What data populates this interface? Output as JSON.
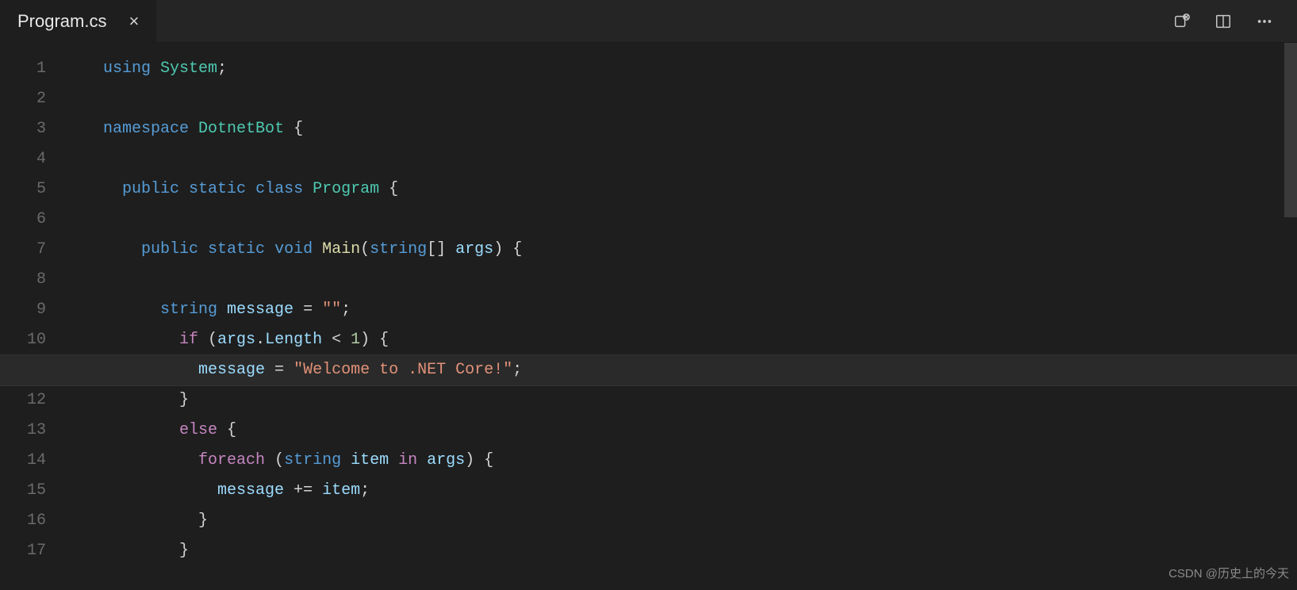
{
  "tab": {
    "title": "Program.cs"
  },
  "icons": {
    "openChanges": "open-changes-icon",
    "splitEditor": "split-editor-icon",
    "more": "more-icon"
  },
  "editor": {
    "lineStart": 1,
    "lineCount": 17,
    "highlightLine": 11,
    "code": {
      "l1": [
        [
          "kw",
          "using"
        ],
        [
          "pn",
          " "
        ],
        [
          "type",
          "System"
        ],
        [
          "pn",
          ";"
        ]
      ],
      "l2": [],
      "l3": [
        [
          "kw",
          "namespace"
        ],
        [
          "pn",
          " "
        ],
        [
          "type",
          "DotnetBot"
        ],
        [
          "pn",
          " {"
        ]
      ],
      "l4": [],
      "l5": [
        [
          "pn",
          "  "
        ],
        [
          "kw",
          "public"
        ],
        [
          "pn",
          " "
        ],
        [
          "kw",
          "static"
        ],
        [
          "pn",
          " "
        ],
        [
          "kw",
          "class"
        ],
        [
          "pn",
          " "
        ],
        [
          "type",
          "Program"
        ],
        [
          "pn",
          " {"
        ]
      ],
      "l6": [],
      "l7": [
        [
          "pn",
          "    "
        ],
        [
          "kw",
          "public"
        ],
        [
          "pn",
          " "
        ],
        [
          "kw",
          "static"
        ],
        [
          "pn",
          " "
        ],
        [
          "kw",
          "void"
        ],
        [
          "pn",
          " "
        ],
        [
          "fn",
          "Main"
        ],
        [
          "pn",
          "("
        ],
        [
          "kw",
          "string"
        ],
        [
          "pn",
          "[] "
        ],
        [
          "var",
          "args"
        ],
        [
          "pn",
          ") {"
        ]
      ],
      "l8": [],
      "l9": [
        [
          "pn",
          "      "
        ],
        [
          "kw",
          "string"
        ],
        [
          "pn",
          " "
        ],
        [
          "var",
          "message"
        ],
        [
          "pn",
          " = "
        ],
        [
          "str",
          "\"\""
        ],
        [
          "pn",
          ";"
        ]
      ],
      "l10": [
        [
          "pn",
          "        "
        ],
        [
          "kwp",
          "if"
        ],
        [
          "pn",
          " ("
        ],
        [
          "var",
          "args"
        ],
        [
          "pn",
          "."
        ],
        [
          "var",
          "Length"
        ],
        [
          "pn",
          " < "
        ],
        [
          "num",
          "1"
        ],
        [
          "pn",
          ") {"
        ]
      ],
      "l11": [
        [
          "pn",
          "          "
        ],
        [
          "var",
          "message"
        ],
        [
          "pn",
          " = "
        ],
        [
          "str",
          "\"Welcome to .NET Core!\""
        ],
        [
          "pn",
          ";"
        ]
      ],
      "l12": [
        [
          "pn",
          "        }"
        ]
      ],
      "l13": [
        [
          "pn",
          "        "
        ],
        [
          "kwp",
          "else"
        ],
        [
          "pn",
          " {"
        ]
      ],
      "l14": [
        [
          "pn",
          "          "
        ],
        [
          "kwp",
          "foreach"
        ],
        [
          "pn",
          " ("
        ],
        [
          "kw",
          "string"
        ],
        [
          "pn",
          " "
        ],
        [
          "var",
          "item"
        ],
        [
          "pn",
          " "
        ],
        [
          "kwp",
          "in"
        ],
        [
          "pn",
          " "
        ],
        [
          "var",
          "args"
        ],
        [
          "pn",
          ") {"
        ]
      ],
      "l15": [
        [
          "pn",
          "            "
        ],
        [
          "var",
          "message"
        ],
        [
          "pn",
          " += "
        ],
        [
          "var",
          "item"
        ],
        [
          "pn",
          ";"
        ]
      ],
      "l16": [
        [
          "pn",
          "          }"
        ]
      ],
      "l17": [
        [
          "pn",
          "        }"
        ]
      ]
    }
  },
  "watermark": "CSDN @历史上的今天"
}
